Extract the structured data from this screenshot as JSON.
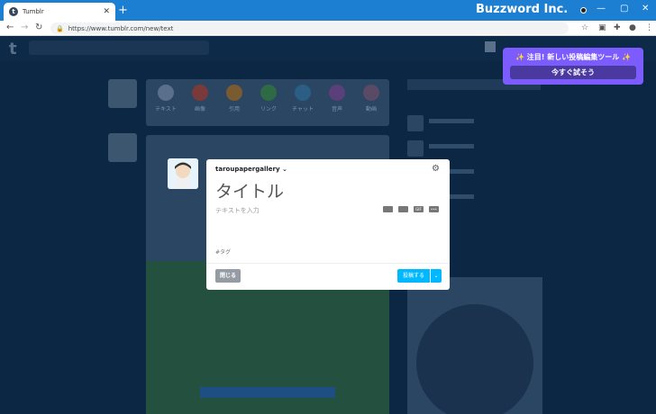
{
  "browser": {
    "tab_title": "Tumblr",
    "tab_favicon": "t",
    "tab_close": "✕",
    "new_tab": "+",
    "url": "https://www.tumblr.com/new/text",
    "brand": "Buzzword Inc."
  },
  "promo": {
    "title": "✨ 注目! 新しい投稿編集ツール ✨",
    "button": "今すぐ試そう"
  },
  "dashboard": {
    "post_types": [
      "テキスト",
      "画像",
      "引用",
      "リンク",
      "チャット",
      "音声",
      "動画"
    ]
  },
  "dialog": {
    "blog_name": "taroupapergallery ⌄",
    "title_placeholder": "タイトル",
    "text_placeholder": "テキストを入力",
    "tags_placeholder": "#タグ",
    "close_label": "閉じる",
    "post_label": "投稿する",
    "gif_label": "GIF"
  }
}
